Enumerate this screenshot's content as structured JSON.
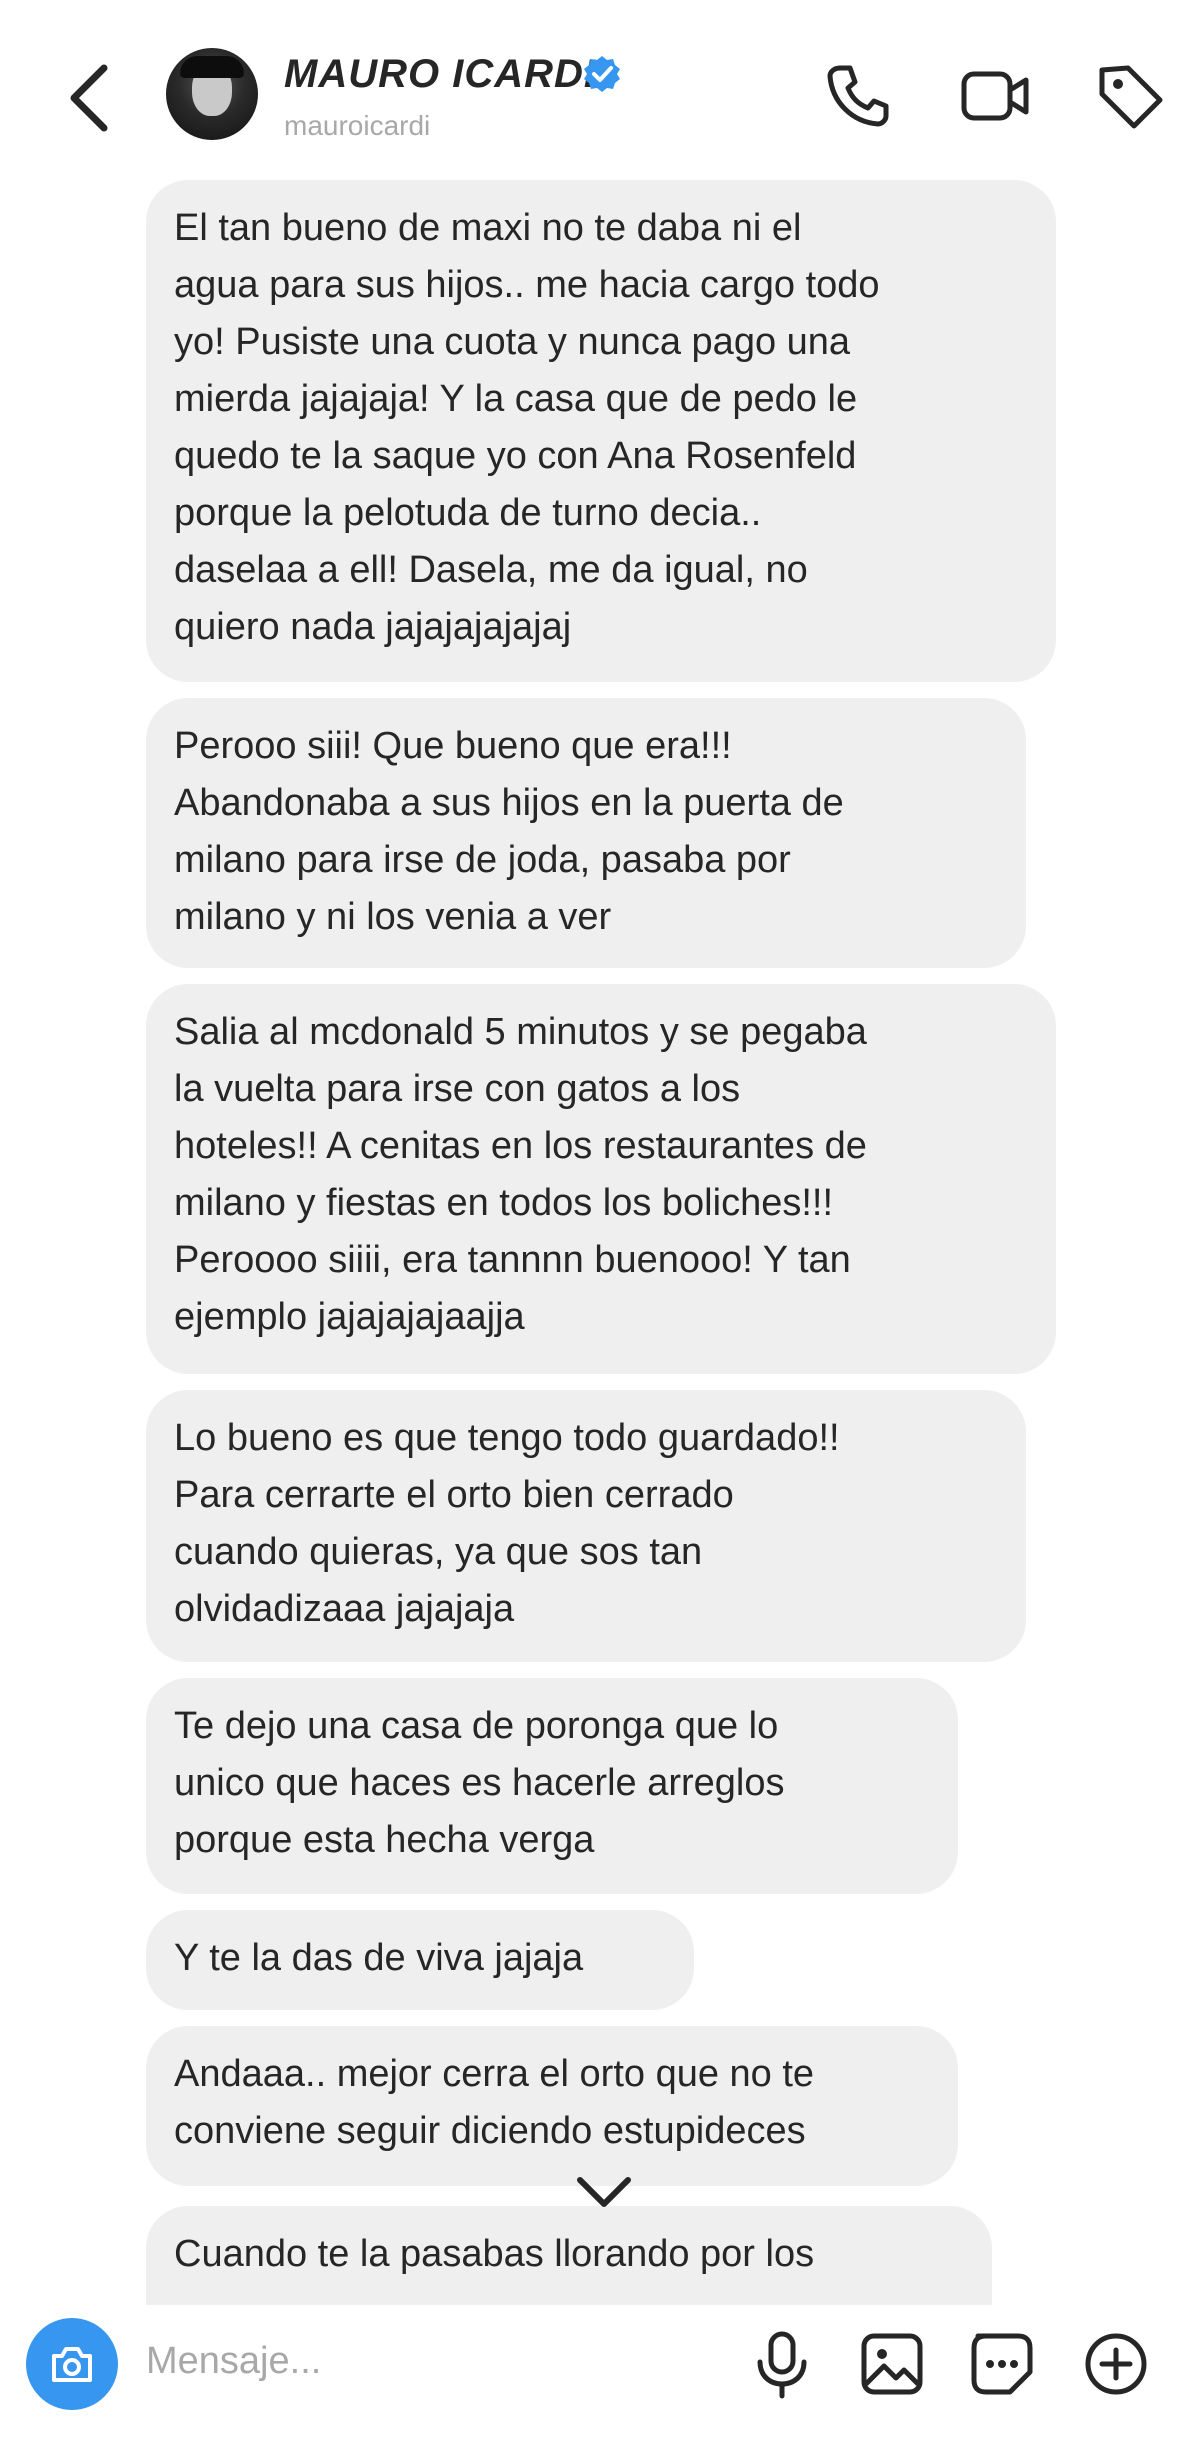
{
  "header": {
    "name": "MAURO ICARDI",
    "handle": "mauroicardi",
    "verified": true,
    "icons": [
      "back-arrow-icon",
      "phone-icon",
      "video-call-icon",
      "tag-icon"
    ]
  },
  "messages": [
    {
      "text": "El tan bueno de maxi no te daba ni el\nagua para sus hijos.. me hacia cargo todo\nyo! Pusiste una cuota y nunca pago una\nmierda jajajaja! Y la casa que de pedo le\nquedo te la saque yo con Ana Rosenfeld\nporque la pelotuda de turno decia..\ndaselaa a ell! Dasela, me da igual, no\nquiero nada jajajajajajaj"
    },
    {
      "text": "Perooo siii! Que bueno que era!!!\nAbandonaba a sus hijos en la puerta de\nmilano para irse de joda, pasaba por\nmilano y ni los venia a ver"
    },
    {
      "text": "Salia al mcdonald 5 minutos y se pegaba\nla vuelta para irse con gatos a los\nhoteles!! A cenitas en los restaurantes de\nmilano y fiestas en todos los boliches!!!\nPeroooo siiii, era tannnn buenooo! Y tan\nejemplo jajajajajaajja"
    },
    {
      "text": "Lo bueno es que tengo todo guardado!!\nPara cerrarte el orto bien cerrado\ncuando quieras, ya que sos tan\nolvidadizaaa jajajaja"
    },
    {
      "text": "Te dejo una casa de poronga que lo\nunico que haces es hacerle arreglos\nporque esta hecha verga"
    },
    {
      "text": "Y te la das de viva jajaja"
    },
    {
      "text": "Andaaa.. mejor cerra el orto que no te\nconviene seguir diciendo estupideces"
    },
    {
      "text": "Cuando te la pasabas llorando por los"
    }
  ],
  "composer": {
    "placeholder": "Mensaje...",
    "icons": [
      "camera-icon",
      "microphone-icon",
      "gallery-icon",
      "sticker-icon",
      "plus-icon"
    ]
  },
  "colors": {
    "accent": "#3797f0",
    "bubble": "#efefef",
    "text": "#262626",
    "secondary_text": "#a8a8a8"
  }
}
